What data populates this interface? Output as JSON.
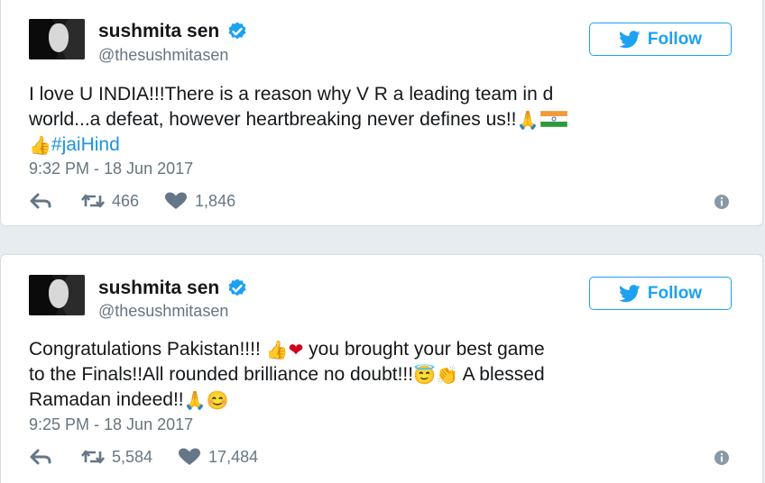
{
  "tweets": [
    {
      "name": "sushmita sen",
      "handle": "@thesushmitasen",
      "follow_label": "Follow",
      "text_line1": "I love U INDIA!!!There is a reason why V R a leading team in d",
      "text_line2_a": "world...a defeat, however heartbreaking never defines us!!",
      "hashtag": "#jaiHind",
      "timestamp": "9:32 PM - 18 Jun 2017",
      "retweets": "466",
      "likes": "1,846"
    },
    {
      "name": "sushmita sen",
      "handle": "@thesushmitasen",
      "follow_label": "Follow",
      "text_line1_a": "Congratulations Pakistan!!!! ",
      "text_line1_b": " you brought your best game",
      "text_line2_a": "to the Finals!!All rounded brilliance no doubt!!!",
      "text_line2_b": " A blessed",
      "text_line3_a": "Ramadan indeed!!",
      "timestamp": "9:25 PM - 18 Jun 2017",
      "retweets": "5,584",
      "likes": "17,484"
    }
  ],
  "icons": {
    "verified": "verified-badge-icon",
    "bird": "twitter-bird-icon",
    "reply": "reply-icon",
    "retweet": "retweet-icon",
    "like": "heart-icon",
    "info": "info-icon"
  },
  "colors": {
    "accent": "#1da1f2",
    "hashtag": "#1b95e0",
    "muted": "#66757f",
    "background": "#e6ecf0"
  }
}
